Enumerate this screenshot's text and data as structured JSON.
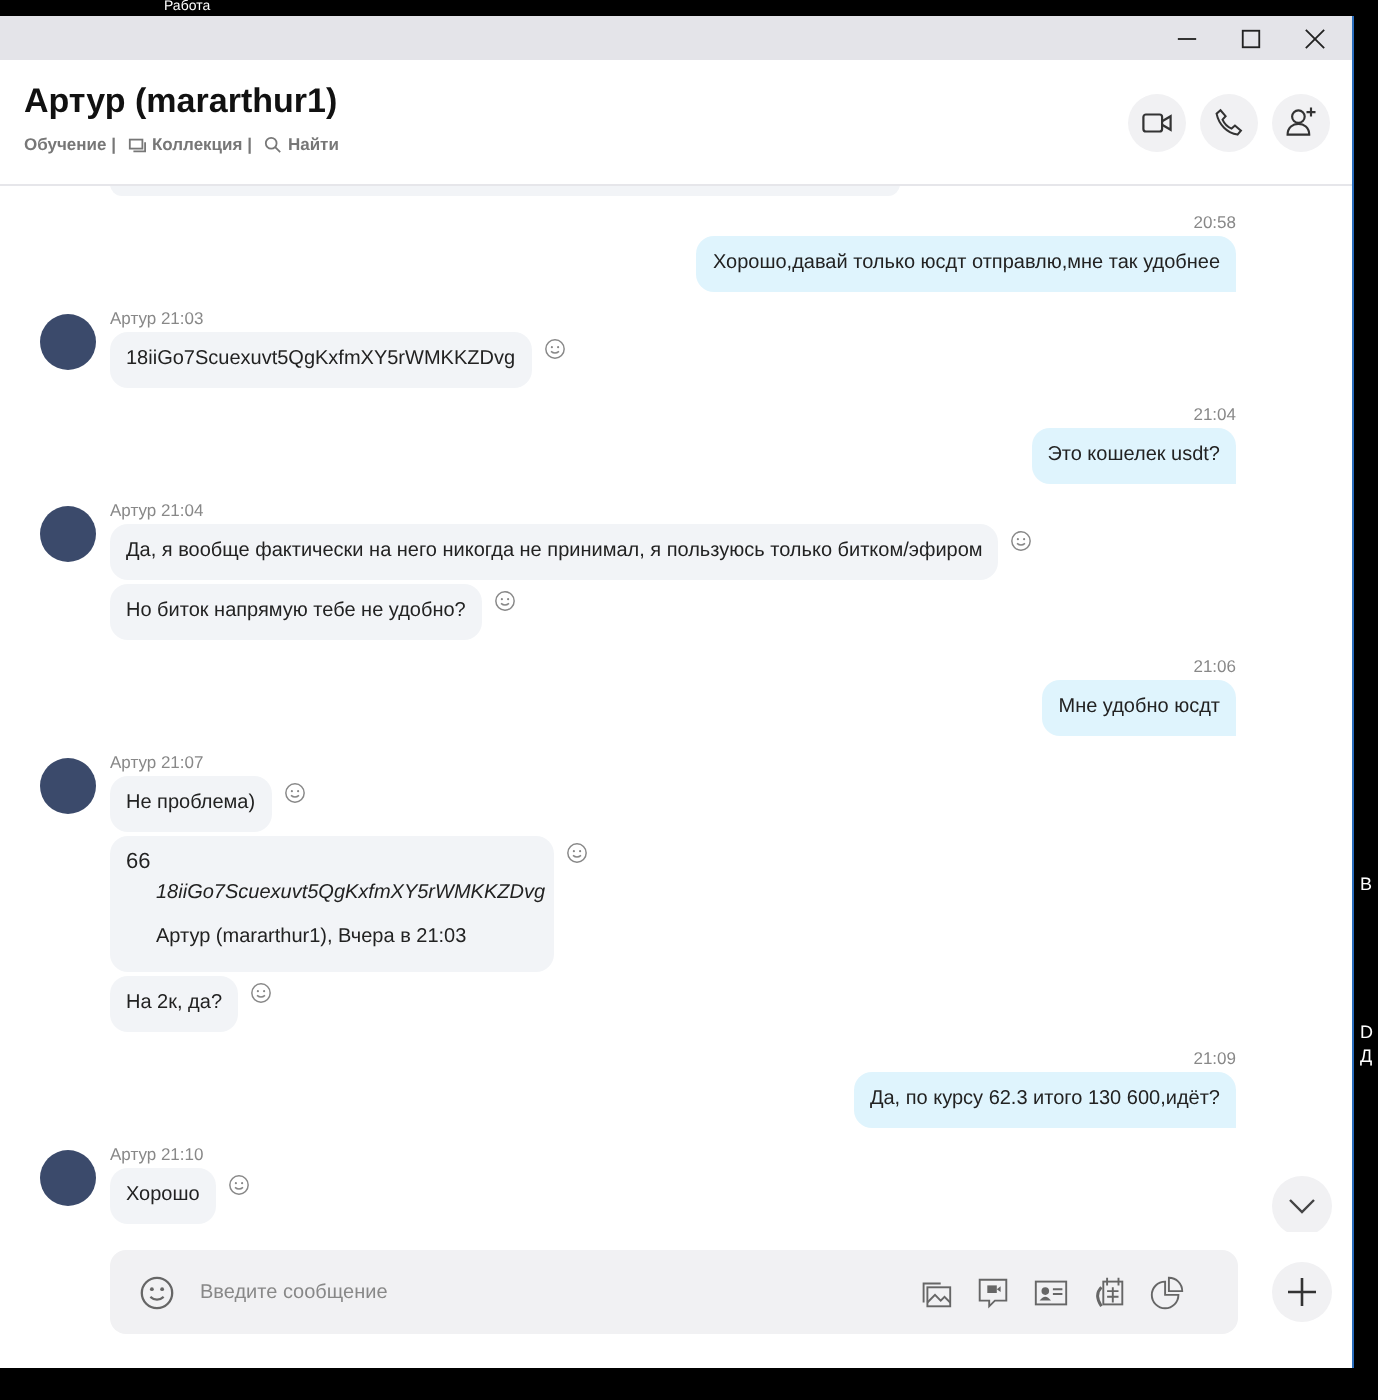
{
  "desktop": {
    "top_label": "Работа",
    "edge_labels": [
      "В",
      "D",
      "Д"
    ]
  },
  "header": {
    "title": "Артур (mararthur1)",
    "links": [
      {
        "kind": "text",
        "label": "Обучение |"
      },
      {
        "kind": "gallery",
        "label": "Коллекция |"
      },
      {
        "kind": "search",
        "label": "Найти"
      }
    ]
  },
  "messages": [
    {
      "kind": "out",
      "time": "20:58",
      "items": [
        {
          "kind": "text",
          "text": "Хорошо,давай только юсдт отправлю,мне так удобнее"
        }
      ]
    },
    {
      "kind": "in",
      "author": "Артур 21:03",
      "items": [
        {
          "kind": "text",
          "text": "18iiGo7Scuexuvt5QgKxfmXY5rWMKKZDvg"
        }
      ]
    },
    {
      "kind": "out",
      "time": "21:04",
      "items": [
        {
          "kind": "text",
          "text": "Это кошелек usdt?"
        }
      ]
    },
    {
      "kind": "in",
      "author": "Артур 21:04",
      "items": [
        {
          "kind": "text",
          "text": "Да, я вообще фактически на него никогда не принимал, я пользуюсь только битком/эфиром"
        },
        {
          "kind": "text",
          "text": "Но биток напрямую тебе не удобно?"
        }
      ]
    },
    {
      "kind": "out",
      "time": "21:06",
      "items": [
        {
          "kind": "text",
          "text": "Мне удобно юсдт"
        }
      ]
    },
    {
      "kind": "in",
      "author": "Артур 21:07",
      "items": [
        {
          "kind": "text",
          "text": "Не проблема)"
        },
        {
          "kind": "quote",
          "mark": "66",
          "text": "18iiGo7Scuexuvt5QgKxfmXY5rWMKKZDvg",
          "source": "Артур (mararthur1), Вчера в 21:03"
        },
        {
          "kind": "text",
          "text": "На 2к, да?"
        }
      ]
    },
    {
      "kind": "out",
      "time": "21:09",
      "items": [
        {
          "kind": "text",
          "text": "Да, по курсу 62.3 итого 130 600,идёт?"
        }
      ]
    },
    {
      "kind": "in",
      "author": "Артур 21:10",
      "items": [
        {
          "kind": "text",
          "text": "Хорошо"
        }
      ]
    }
  ],
  "composer": {
    "placeholder": "Введите сообщение"
  }
}
